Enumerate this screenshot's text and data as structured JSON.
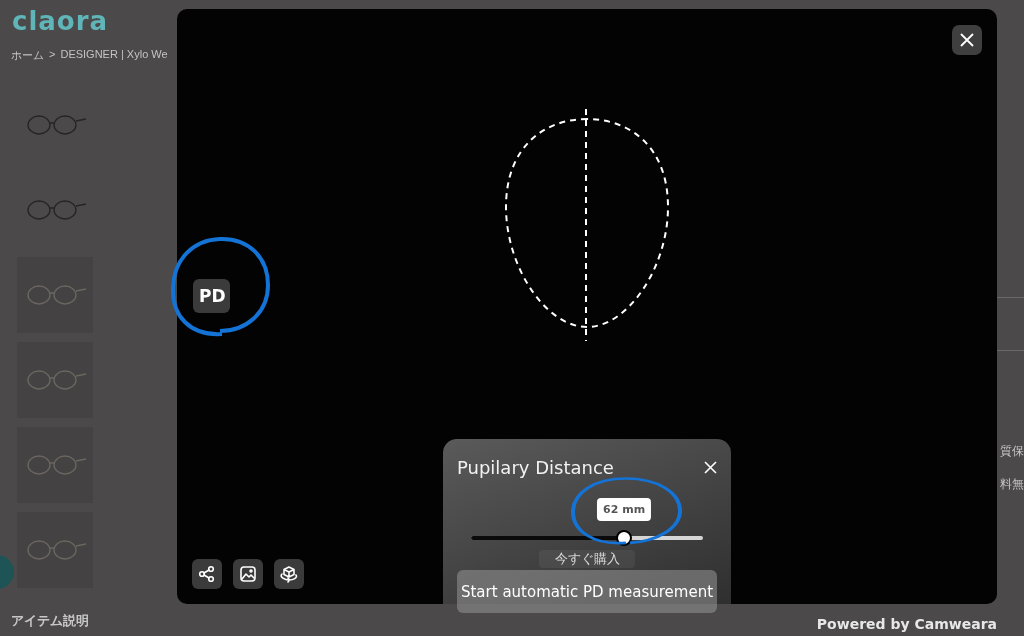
{
  "page": {
    "logo": "claora",
    "breadcrumb": [
      {
        "label": "ホーム"
      },
      {
        "label": "DESIGNER | Xylo We"
      }
    ],
    "breadcrumb_separator": ">",
    "section_title": "アイテム説明",
    "side_texts": [
      "質保",
      "料無"
    ],
    "behind_button": "今すぐ購入"
  },
  "modal": {
    "pd_label": "PD",
    "toolbar": [
      {
        "kind": "share"
      },
      {
        "kind": "image"
      },
      {
        "kind": "cube"
      }
    ],
    "panel": {
      "title": "Pupilary Distance",
      "slider": {
        "level": 0.66,
        "reading": "62 mm"
      },
      "button": "Start automatic PD measurement"
    }
  },
  "footer": {
    "credit": "Powered by Camweara"
  }
}
